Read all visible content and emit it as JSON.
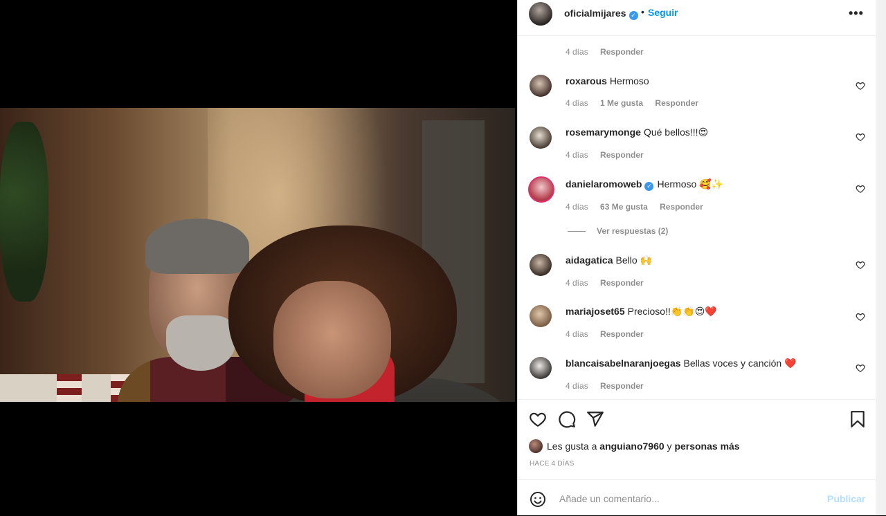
{
  "post": {
    "username": "oficialmijares",
    "dot": "•",
    "follow_label": "Seguir",
    "more": "•••"
  },
  "comments": [
    {
      "username": "",
      "text": "",
      "time": "4 días",
      "likes": "",
      "reply": "Responder"
    },
    {
      "username": "roxarous",
      "text": "Hermoso",
      "time": "4 días",
      "likes": "1 Me gusta",
      "reply": "Responder"
    },
    {
      "username": "rosemarymonge",
      "text": "Qué bellos!!!😍",
      "time": "4 días",
      "likes": "",
      "reply": "Responder"
    },
    {
      "username": "danielaromoweb",
      "text": "Hermoso 🥰✨",
      "time": "4 días",
      "likes": "63 Me gusta",
      "reply": "Responder",
      "replies": "Ver respuestas (2)"
    },
    {
      "username": "aidagatica",
      "text": "Bello 🙌",
      "time": "4 días",
      "likes": "",
      "reply": "Responder"
    },
    {
      "username": "mariajoset65",
      "text": "Precioso!!👏👏😍❤️",
      "time": "4 días",
      "likes": "",
      "reply": "Responder"
    },
    {
      "username": "blancaisabelnaranjoegas",
      "text": "Bellas voces y canción ❤️",
      "time": "4 días",
      "likes": "",
      "reply": "Responder"
    }
  ],
  "likes": {
    "prefix": "Les gusta a",
    "user": "anguiano7960",
    "and": "y",
    "others": "personas más"
  },
  "timestamp": "HACE 4 DÍAS",
  "add_comment": {
    "placeholder": "Añade un comentario...",
    "publish_label": "Publicar"
  },
  "icons": {
    "verified": "verified-badge-icon",
    "heart": "heart-icon",
    "comment": "comment-icon",
    "share": "share-icon",
    "save": "bookmark-icon",
    "emoji": "emoji-icon"
  },
  "colors": {
    "accent": "#0095f6",
    "publish_disabled": "#b2dffc",
    "verified": "#3897f0",
    "muted": "#8e8e8e"
  }
}
